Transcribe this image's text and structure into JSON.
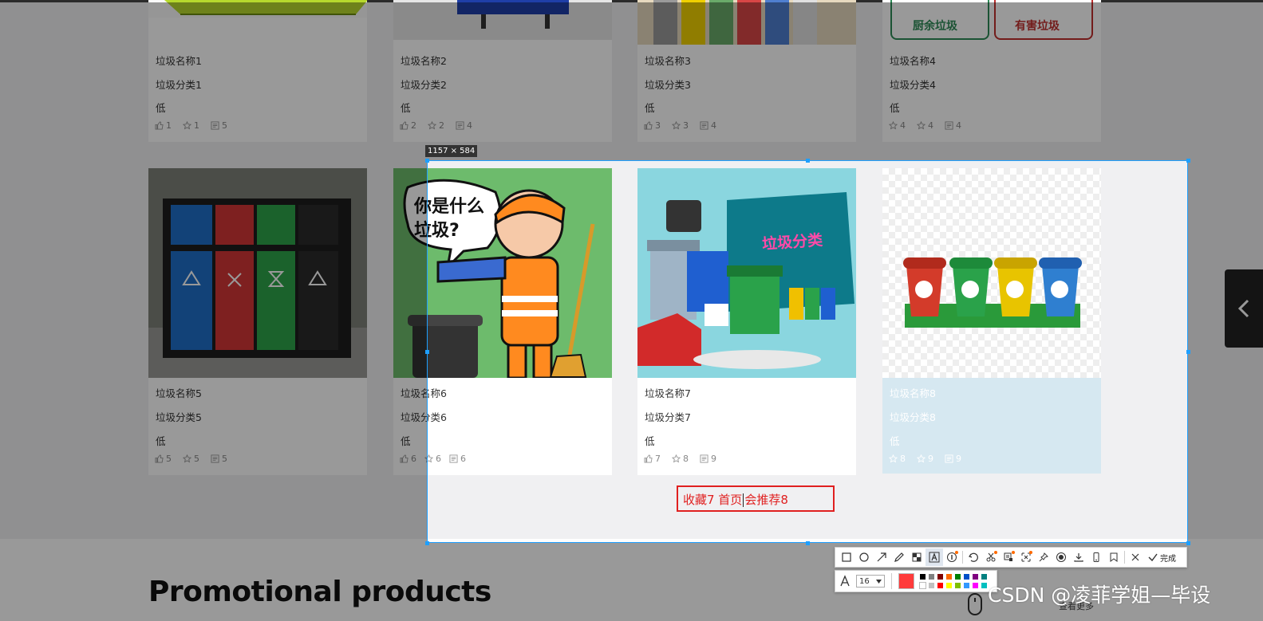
{
  "row1": [
    {
      "name": "垃圾名称1",
      "category": "垃圾分类1",
      "level": "低",
      "likes": "1",
      "favorites": "1",
      "comments": "5"
    },
    {
      "name": "垃圾名称2",
      "category": "垃圾分类2",
      "level": "低",
      "likes": "2",
      "favorites": "2",
      "comments": "4"
    },
    {
      "name": "垃圾名称3",
      "category": "垃圾分类3",
      "level": "低",
      "likes": "3",
      "favorites": "3",
      "comments": "4"
    },
    {
      "name": "垃圾名称4",
      "category": "垃圾分类4",
      "level": "低",
      "likes": "4",
      "favorites": "4",
      "comments": "4"
    }
  ],
  "row1_image_text": {
    "food_waste": "厨余垃圾",
    "hazardous": "有害垃圾"
  },
  "row2": [
    {
      "name": "垃圾名称5",
      "category": "垃圾分类5",
      "level": "低",
      "likes": "5",
      "favorites": "5",
      "comments": "5"
    },
    {
      "name": "垃圾名称6",
      "category": "垃圾分类6",
      "level": "低",
      "likes": "6",
      "favorites": "6",
      "comments": "6"
    },
    {
      "name": "垃圾名称7",
      "category": "垃圾分类7",
      "level": "低",
      "likes": "7",
      "favorites": "8",
      "comments": "9"
    },
    {
      "name": "垃圾名称8",
      "category": "垃圾分类8",
      "level": "低",
      "likes": "8",
      "favorites": "9",
      "comments": "9"
    }
  ],
  "images": {
    "cartoon_bubble": "你是什么垃圾?",
    "box_title": "垃圾分类"
  },
  "section": {
    "title": "Promotional products",
    "more": "查看更多"
  },
  "screenshot_tool": {
    "dimensions": "1157 × 584",
    "annotation_text_before": "收藏7 首页",
    "annotation_text_after": "会推荐8",
    "done_label": "完成",
    "font_size": "16",
    "active_color": "#ff3b3b",
    "palette": [
      "#000000",
      "#808080",
      "#800000",
      "#ff6a00",
      "#008000",
      "#0050c8",
      "#800080",
      "#008080",
      "#ffffff",
      "#c0c0c0",
      "#ff0000",
      "#ffff00",
      "#80c000",
      "#3399ff",
      "#ff00ff",
      "#00c0c0"
    ]
  },
  "watermark": "CSDN @凌菲学姐—毕设"
}
